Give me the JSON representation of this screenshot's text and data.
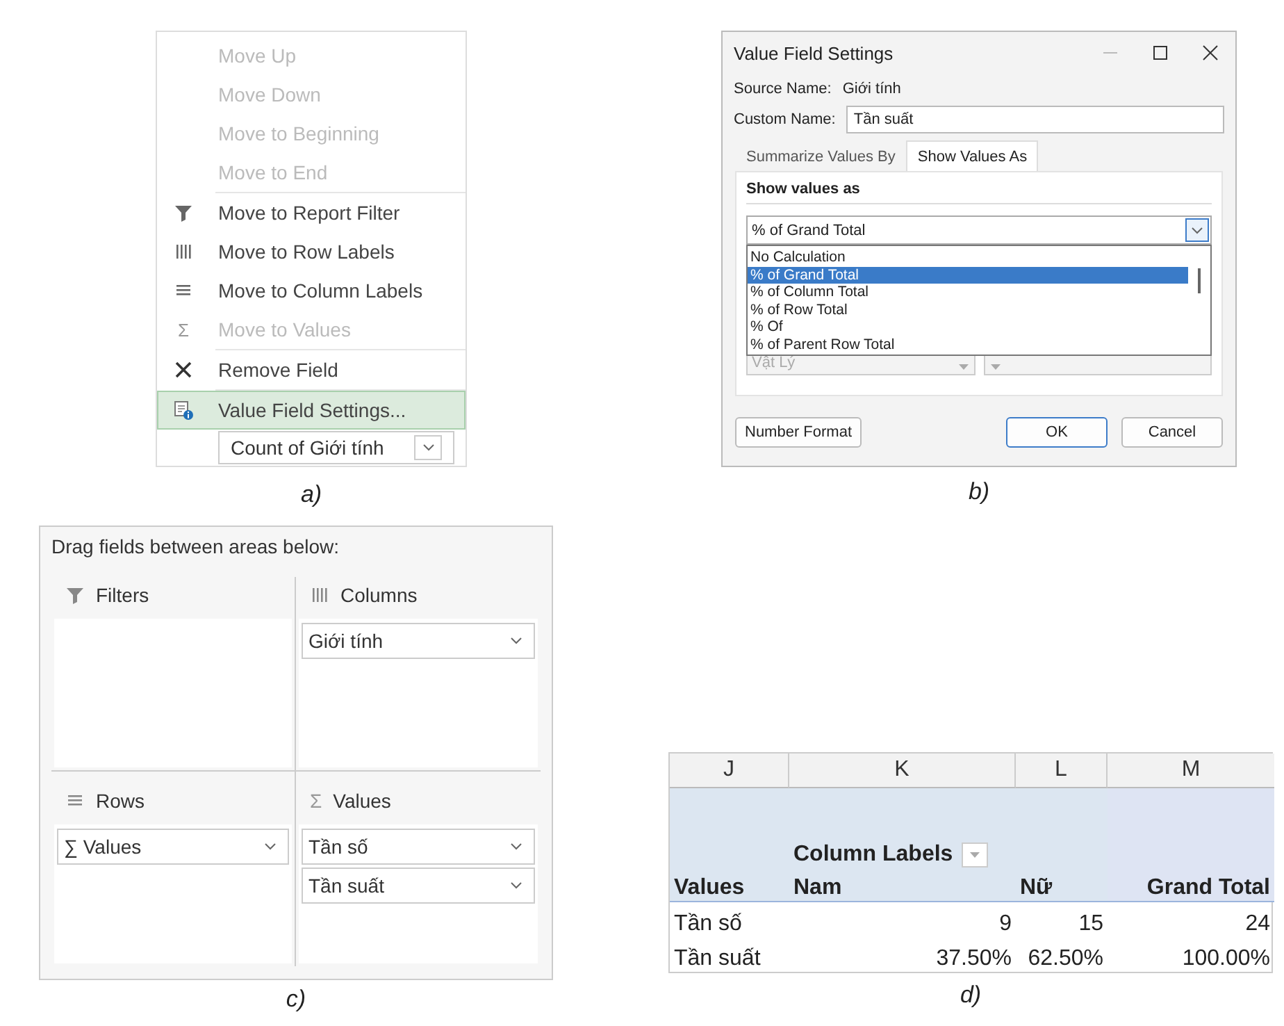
{
  "figure_a": {
    "caption": "a)",
    "menu_items": [
      {
        "label": "Move Up",
        "disabled": true,
        "selected": false,
        "separator_before": false,
        "kind": "plain"
      },
      {
        "label": "Move Down",
        "disabled": true,
        "selected": false,
        "separator_before": false,
        "kind": "plain"
      },
      {
        "label": "Move to Beginning",
        "disabled": true,
        "selected": false,
        "separator_before": false,
        "kind": "plain"
      },
      {
        "label": "Move to End",
        "disabled": true,
        "selected": false,
        "separator_before": false,
        "kind": "plain"
      },
      {
        "label": "Move to Report Filter",
        "disabled": false,
        "selected": false,
        "separator_before": true,
        "kind": "filter"
      },
      {
        "label": "Move to Row Labels",
        "disabled": false,
        "selected": false,
        "separator_before": false,
        "kind": "columns"
      },
      {
        "label": "Move to Column Labels",
        "disabled": false,
        "selected": false,
        "separator_before": false,
        "kind": "rows"
      },
      {
        "label": "Move to Values",
        "disabled": true,
        "selected": false,
        "separator_before": false,
        "kind": "glyph",
        "icon_text": "Σ"
      },
      {
        "label": "Remove Field",
        "disabled": false,
        "selected": false,
        "separator_before": true,
        "kind": "cross"
      },
      {
        "label": "Value Field Settings...",
        "disabled": false,
        "selected": true,
        "separator_before": true,
        "kind": "settings"
      }
    ],
    "field_button": {
      "label": "Count of Giới tính"
    }
  },
  "figure_b": {
    "caption": "b)",
    "window": {
      "title": "Value Field Settings"
    },
    "source_label": "Source Name:",
    "source_value": "Giới tính",
    "custom_label": "Custom Name:",
    "custom_value": "Tần suất",
    "tabs": [
      {
        "label": "Summarize Values By",
        "selected": false
      },
      {
        "label": "Show Values As",
        "selected": true
      }
    ],
    "group_label": "Show values as",
    "combo_value": "% of Grand Total",
    "options": [
      {
        "label": "No Calculation",
        "selected": false
      },
      {
        "label": "% of Grand Total",
        "selected": true
      },
      {
        "label": "% of Column Total",
        "selected": false
      },
      {
        "label": "% of Row Total",
        "selected": false
      },
      {
        "label": "% Of",
        "selected": false
      },
      {
        "label": "% of Parent Row Total",
        "selected": false
      }
    ],
    "base_field_item": "Vật Lý",
    "buttons": [
      {
        "label": "Number Format",
        "kind": "left"
      },
      {
        "label": "OK",
        "kind": "default"
      },
      {
        "label": "Cancel",
        "kind": "normal"
      }
    ]
  },
  "figure_c": {
    "caption": "c)",
    "header": "Drag fields between areas below:",
    "areas": [
      {
        "title": "Filters",
        "kind": "filter"
      },
      {
        "title": "Columns",
        "kind": "columns",
        "items": [
          "Giới tính"
        ]
      },
      {
        "title": "Rows",
        "kind": "rows",
        "items": [
          "∑ Values"
        ]
      },
      {
        "title": "Values",
        "kind": "glyph",
        "icon_text": "Σ",
        "items": [
          "Tần số",
          "Tần suất"
        ]
      }
    ]
  },
  "figure_d": {
    "caption": "d)",
    "column_headers": [
      "J",
      "K",
      "L",
      "M"
    ],
    "column_labels": "Column Labels",
    "header_row": [
      "Values",
      "Nam",
      "Nữ",
      "Grand Total"
    ],
    "rows": [
      [
        "Tần số",
        "9",
        "15",
        "24"
      ],
      [
        "Tần suất",
        "37.50%",
        "62.50%",
        "100.00%"
      ]
    ]
  }
}
